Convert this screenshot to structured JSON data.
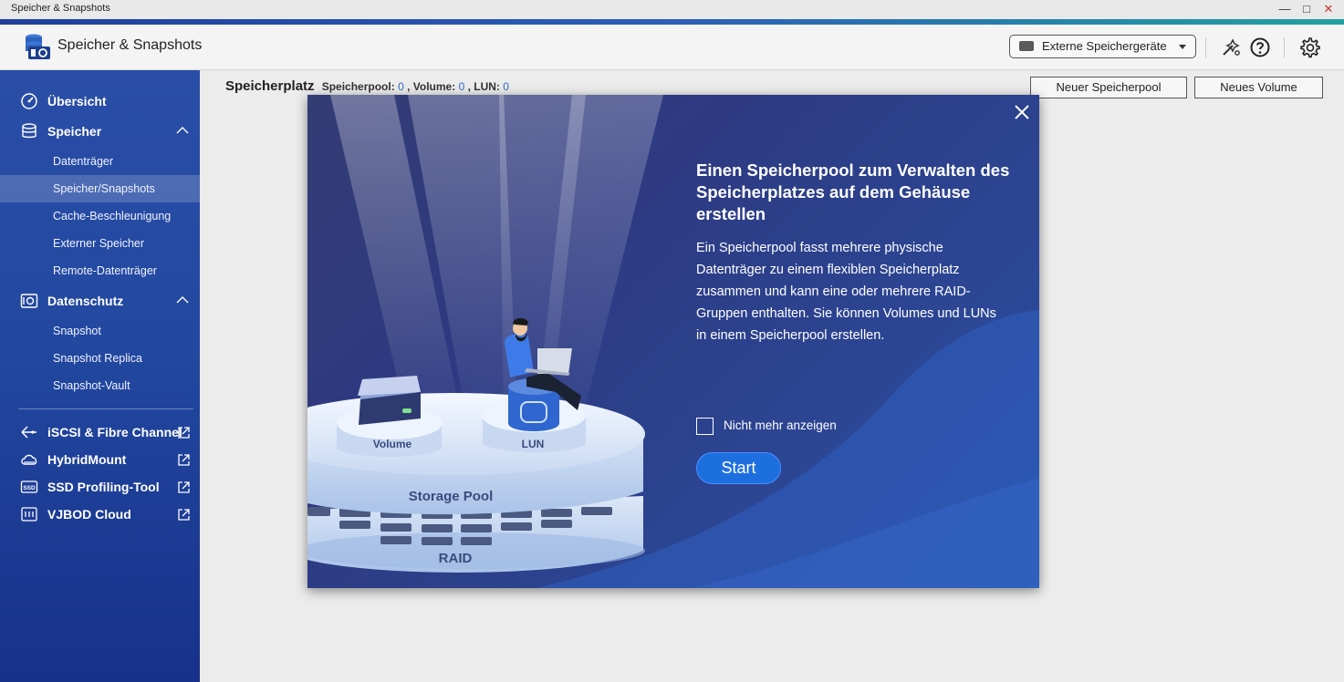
{
  "window": {
    "title": "Speicher & Snapshots",
    "controls": {
      "minimize": "—",
      "maximize": "□",
      "close": "✕"
    }
  },
  "header": {
    "title": "Speicher & Snapshots",
    "external_devices_label": "Externe Speichergeräte",
    "icons": [
      "app-logo-icon",
      "external-drive-icon",
      "dropdown-caret-icon",
      "diagnostics-icon",
      "help-icon",
      "settings-icon"
    ]
  },
  "sidebar": {
    "overview": "Übersicht",
    "storage": {
      "label": "Speicher",
      "items": [
        "Datenträger",
        "Speicher/Snapshots",
        "Cache-Beschleunigung",
        "Externer Speicher",
        "Remote-Datenträger"
      ]
    },
    "protection": {
      "label": "Datenschutz",
      "items": [
        "Snapshot",
        "Snapshot Replica",
        "Snapshot-Vault"
      ]
    },
    "links": [
      "iSCSI & Fibre Channel",
      "HybridMount",
      "SSD Profiling-Tool",
      "VJBOD Cloud"
    ],
    "active_item": "Speicher/Snapshots",
    "ssd_badge": "SSD"
  },
  "main": {
    "title": "Speicherplatz",
    "stats_pool_label": "Speicherpool:",
    "stats_pool_value": "0",
    "stats_volume_label": ", Volume:",
    "stats_volume_value": "0",
    "stats_lun_label": ", LUN:",
    "stats_lun_value": "0",
    "new_pool_button": "Neuer Speicherpool",
    "new_volume_button": "Neues Volume"
  },
  "modal": {
    "title": "Einen Speicherpool zum Verwalten des Speicherplatzes auf dem Gehäuse erstellen",
    "description": "Ein Speicherpool fasst mehrere physische Datenträger zu einem flexiblen Speicherplatz zusammen und kann eine oder mehrere RAID-Gruppen enthalten. Sie können Volumes und LUNs in einem Speicherpool erstellen.",
    "checkbox_label": "Nicht mehr anzeigen",
    "checkbox_checked": false,
    "start_button": "Start",
    "illustration": {
      "volume_label": "Volume",
      "lun_label": "LUN",
      "pool_label": "Storage Pool",
      "raid_label": "RAID"
    }
  }
}
